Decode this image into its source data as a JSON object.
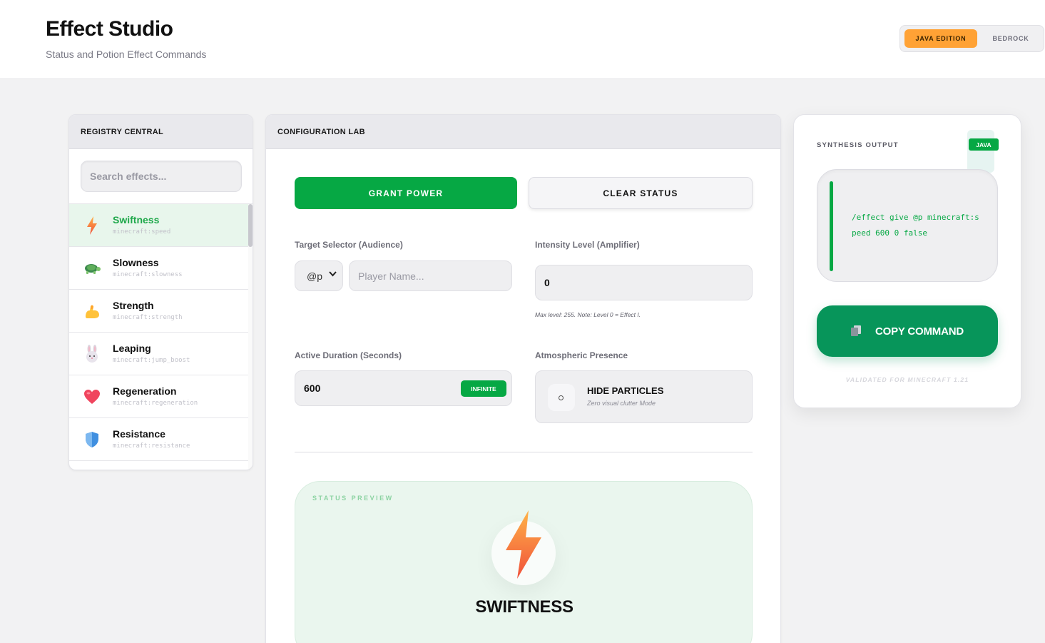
{
  "app": {
    "title": "Effect Studio",
    "subtitle": "Status and Potion Effect Commands"
  },
  "edition": {
    "selected": "JAVA EDITION",
    "options": [
      "JAVA EDITION",
      "BEDROCK"
    ],
    "accent": "#ffa235"
  },
  "registry": {
    "header": "REGISTRY CENTRAL",
    "search_placeholder": "Search effects...",
    "items": [
      {
        "name": "Swiftness",
        "id": "minecraft:speed",
        "icon": "lightning-icon",
        "selected": true
      },
      {
        "name": "Slowness",
        "id": "minecraft:slowness",
        "icon": "turtle-icon",
        "selected": false
      },
      {
        "name": "Strength",
        "id": "minecraft:strength",
        "icon": "flexed-bicep-icon",
        "selected": false
      },
      {
        "name": "Leaping",
        "id": "minecraft:jump_boost",
        "icon": "rabbit-icon",
        "selected": false
      },
      {
        "name": "Regeneration",
        "id": "minecraft:regeneration",
        "icon": "heart-icon",
        "selected": false
      },
      {
        "name": "Resistance",
        "id": "minecraft:resistance",
        "icon": "shield-icon",
        "selected": false
      }
    ]
  },
  "config": {
    "header": "CONFIGURATION LAB",
    "grant_label": "GRANT POWER",
    "clear_label": "CLEAR STATUS",
    "target_label": "Target Selector (Audience)",
    "selector_value": "@p",
    "player_placeholder": "Player Name...",
    "intensity_label": "Intensity Level (Amplifier)",
    "intensity_value": "0",
    "intensity_hint": "Max level: 255. Note: Level 0 = Effect I.",
    "duration_label": "Active Duration (Seconds)",
    "duration_value": "600",
    "infinite_label": "INFINITE",
    "presence_label": "Atmospheric Presence",
    "particles_title": "HIDE PARTICLES",
    "particles_sub": "Zero visual clutter Mode",
    "preview_label": "STATUS PREVIEW",
    "preview_name": "SWIFTNESS",
    "preview_icon": "lightning-icon",
    "brand_green": "#06a844"
  },
  "output": {
    "label": "SYNTHESIS OUTPUT",
    "badge": "JAVA",
    "command": "/effect give @p minecraft:speed 600 0 false",
    "copy_label": "COPY COMMAND",
    "copy_icon": "clipboard-icon",
    "validated": "VALIDATED FOR MINECRAFT 1.21"
  }
}
